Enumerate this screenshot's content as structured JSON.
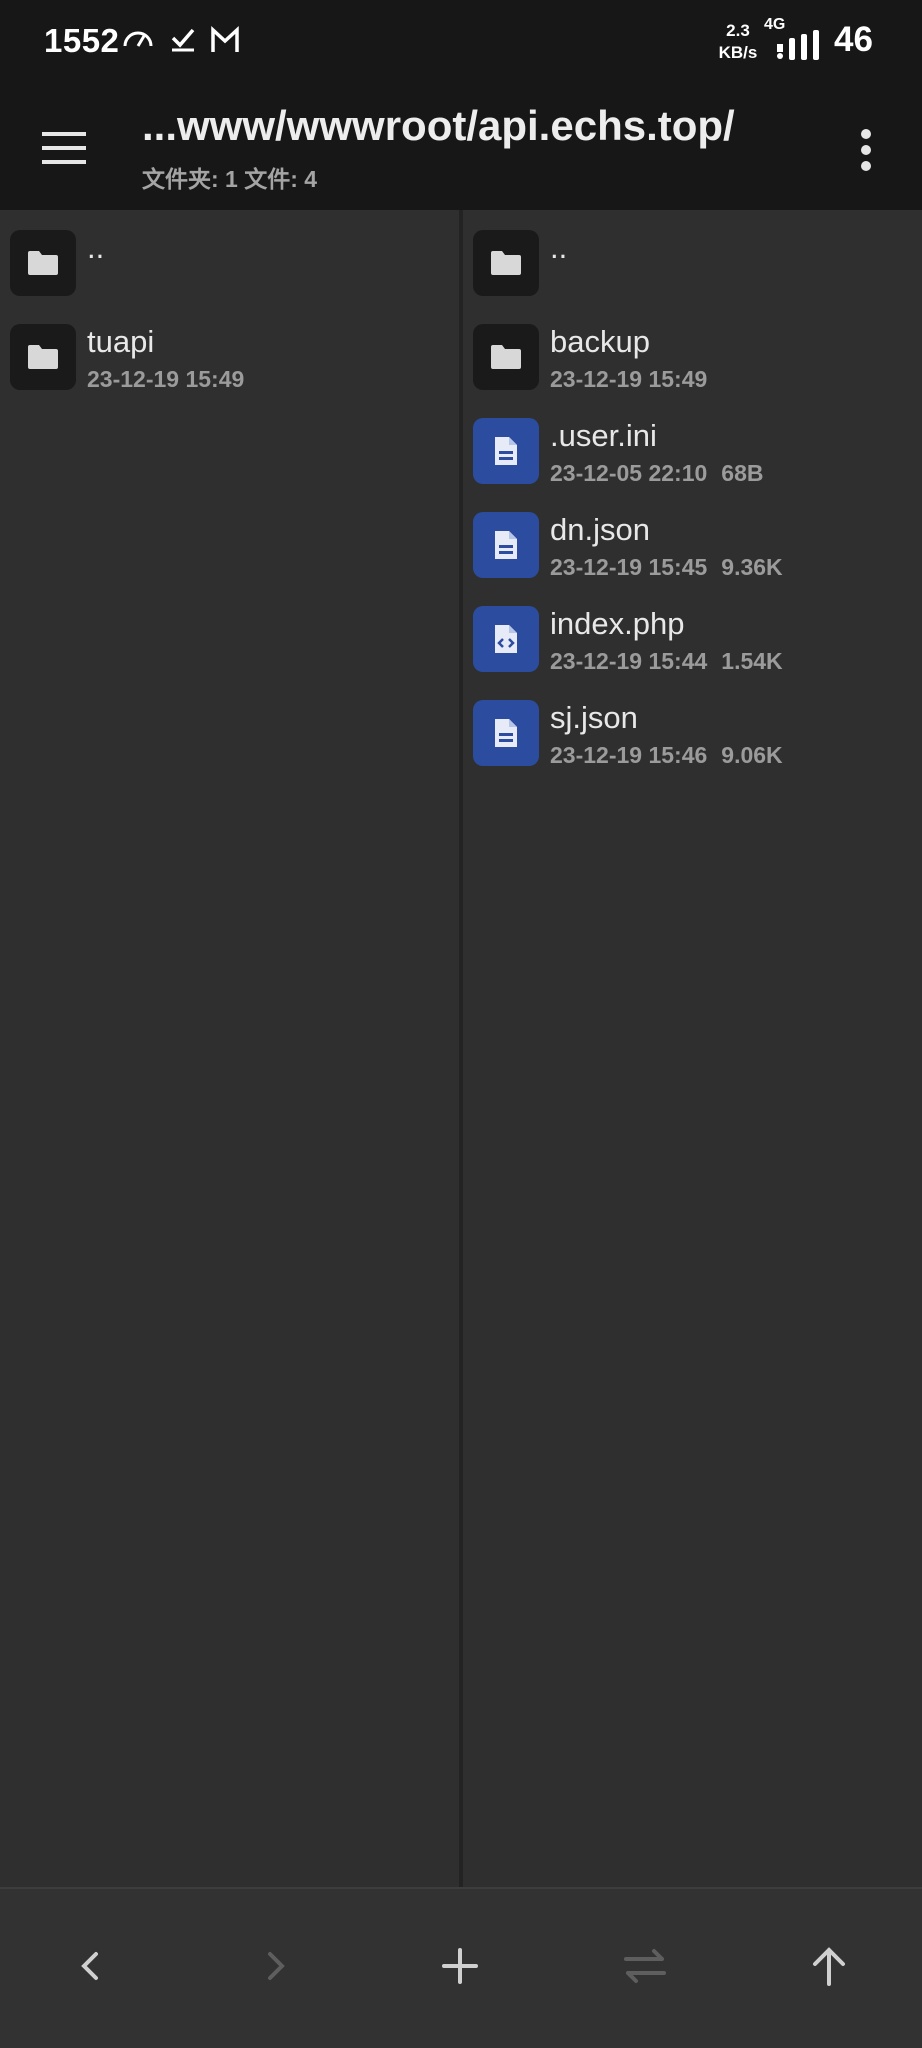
{
  "status_bar": {
    "time": "1552",
    "net_speed_value": "2.3",
    "net_speed_unit": "KB/s",
    "network_type": "4G",
    "battery": "46"
  },
  "app_bar": {
    "title": "...www/wwwroot/api.echs.top/",
    "subtitle": "文件夹: 1  文件: 4"
  },
  "left_pane": {
    "items": [
      {
        "name": "..",
        "type": "folder"
      },
      {
        "name": "tuapi",
        "type": "folder",
        "date": "23-12-19 15:49"
      }
    ]
  },
  "right_pane": {
    "items": [
      {
        "name": "..",
        "type": "folder"
      },
      {
        "name": "backup",
        "type": "folder",
        "date": "23-12-19 15:49"
      },
      {
        "name": ".user.ini",
        "type": "text-file",
        "date": "23-12-05 22:10",
        "size": "68B"
      },
      {
        "name": "dn.json",
        "type": "text-file",
        "date": "23-12-19 15:45",
        "size": "9.36K"
      },
      {
        "name": "index.php",
        "type": "code-file",
        "date": "23-12-19 15:44",
        "size": "1.54K"
      },
      {
        "name": "sj.json",
        "type": "text-file",
        "date": "23-12-19 15:46",
        "size": "9.06K"
      }
    ]
  },
  "bottom_bar": {
    "buttons": [
      "back-icon",
      "forward-icon",
      "add-icon",
      "swap-icon",
      "up-icon"
    ]
  },
  "colors": {
    "background": "#303030",
    "bar": "#171717",
    "file_icon": "#2c4d9f",
    "folder_icon": "#1a1a1a"
  }
}
